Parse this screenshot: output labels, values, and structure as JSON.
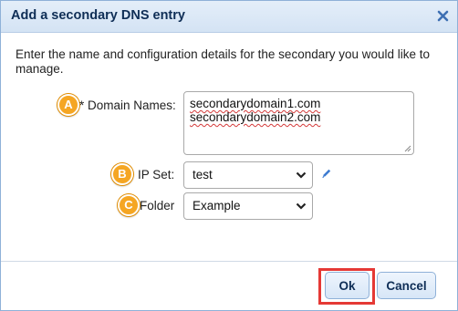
{
  "dialog": {
    "title": "Add a secondary DNS entry",
    "close_icon": "close-icon",
    "description": "Enter the name and configuration details for the secondary you would like to manage."
  },
  "form": {
    "domain_names": {
      "badge": "A",
      "required_marker": "*",
      "label": " Domain Names:",
      "lines": [
        "secondarydomain1.com",
        "secondarydomain2.com"
      ]
    },
    "ip_set": {
      "badge": "B",
      "label": "IP Set:",
      "selected": "test",
      "edit_icon": "pencil-icon"
    },
    "folder": {
      "badge": "C",
      "label": "Folder",
      "selected": "Example"
    }
  },
  "buttons": {
    "ok": "Ok",
    "cancel": "Cancel"
  },
  "colors": {
    "badge": "#f5a623",
    "highlight": "#e53935",
    "title_text": "#0f2e56",
    "link_icon": "#3d7bd0"
  }
}
